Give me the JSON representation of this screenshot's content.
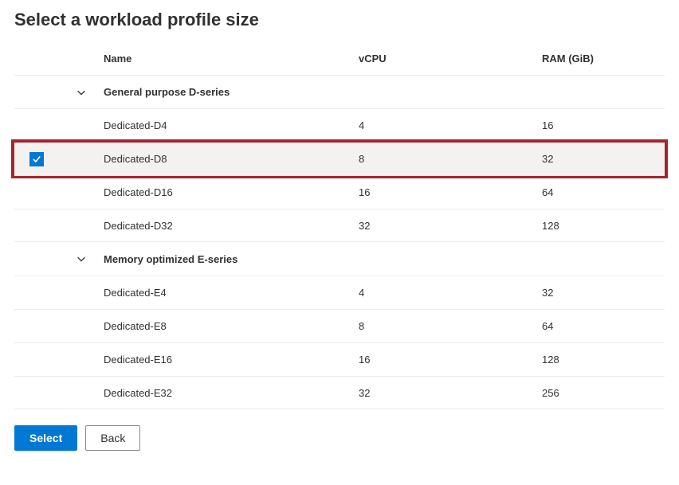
{
  "title": "Select a workload profile size",
  "columns": {
    "name": "Name",
    "vcpu": "vCPU",
    "ram": "RAM (GiB)"
  },
  "groups": [
    {
      "label": "General purpose D-series",
      "items": [
        {
          "checked": false,
          "name": "Dedicated-D4",
          "vcpu": "4",
          "ram": "16",
          "selected": false
        },
        {
          "checked": true,
          "name": "Dedicated-D8",
          "vcpu": "8",
          "ram": "32",
          "selected": true
        },
        {
          "checked": false,
          "name": "Dedicated-D16",
          "vcpu": "16",
          "ram": "64",
          "selected": false
        },
        {
          "checked": false,
          "name": "Dedicated-D32",
          "vcpu": "32",
          "ram": "128",
          "selected": false
        }
      ]
    },
    {
      "label": "Memory optimized E-series",
      "items": [
        {
          "checked": false,
          "name": "Dedicated-E4",
          "vcpu": "4",
          "ram": "32",
          "selected": false
        },
        {
          "checked": false,
          "name": "Dedicated-E8",
          "vcpu": "8",
          "ram": "64",
          "selected": false
        },
        {
          "checked": false,
          "name": "Dedicated-E16",
          "vcpu": "16",
          "ram": "128",
          "selected": false
        },
        {
          "checked": false,
          "name": "Dedicated-E32",
          "vcpu": "32",
          "ram": "256",
          "selected": false
        }
      ]
    }
  ],
  "buttons": {
    "select": "Select",
    "back": "Back"
  }
}
